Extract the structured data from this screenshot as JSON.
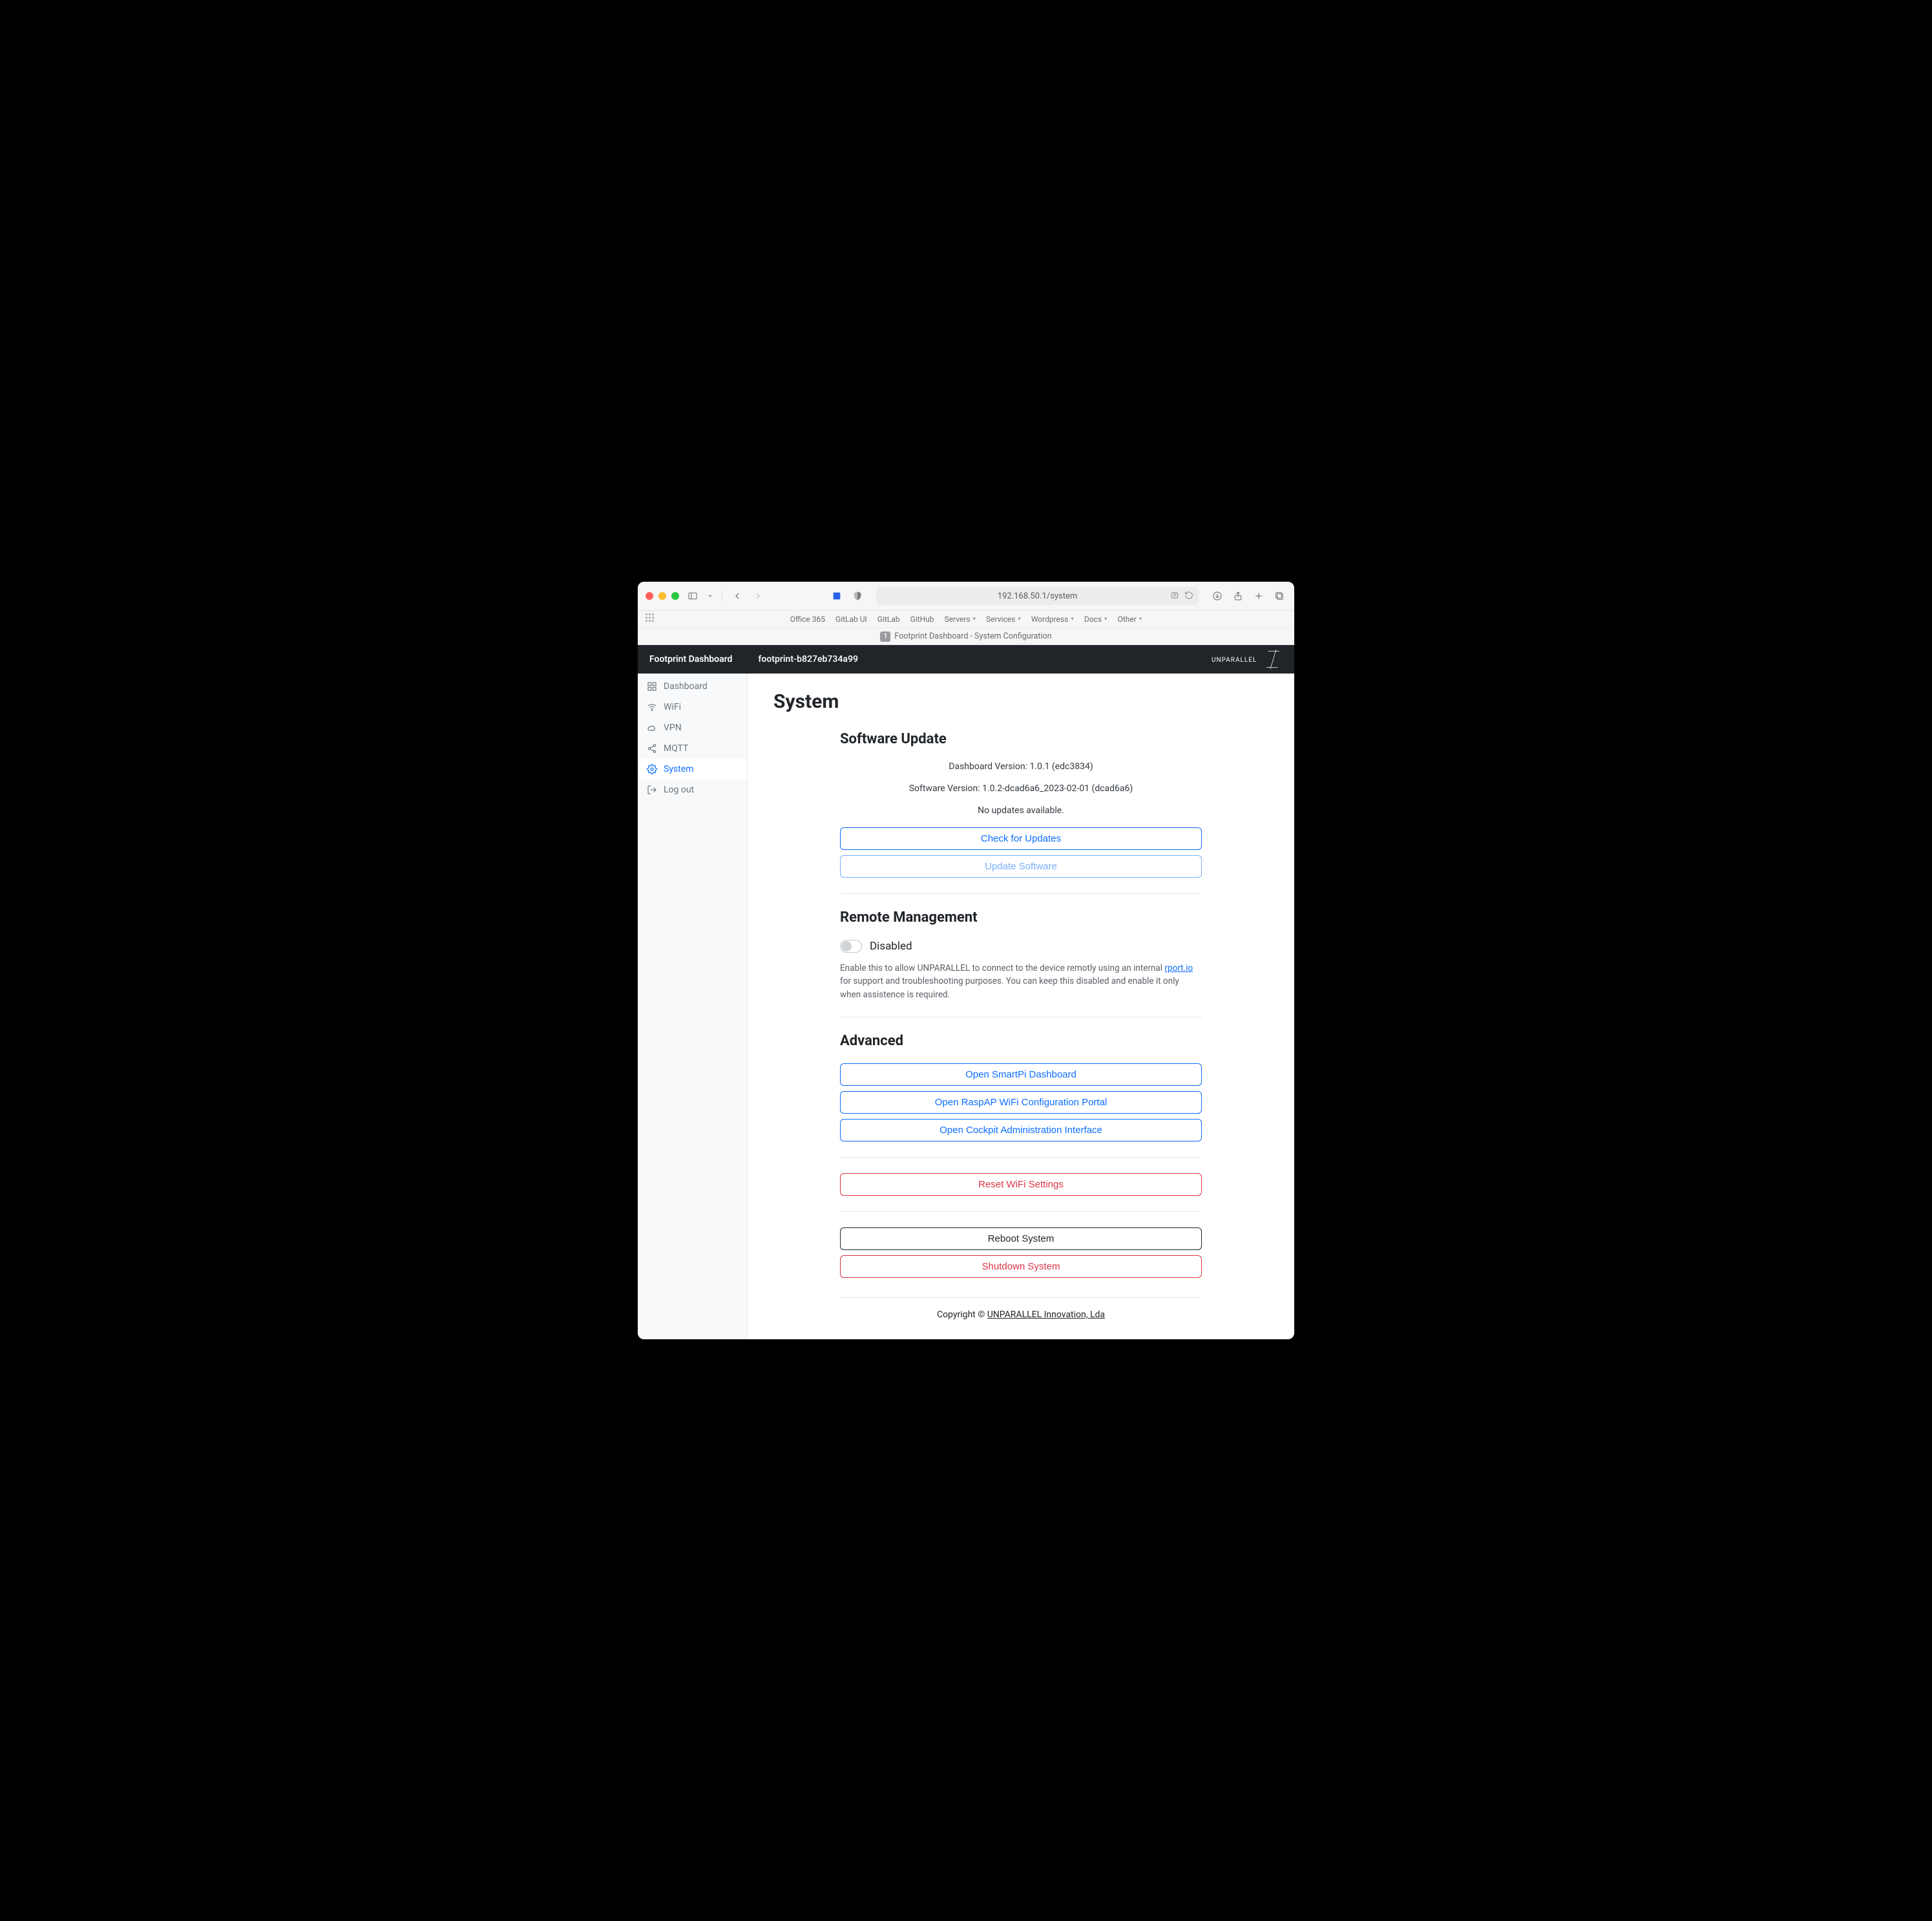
{
  "browser": {
    "url": "192.168.50.1/system",
    "favorites": [
      "Office 365",
      "GitLab UI",
      "GitLab",
      "GitHub",
      "Servers",
      "Services",
      "Wordpress",
      "Docs",
      "Other"
    ],
    "favorites_dropdown": {
      "Servers": true,
      "Services": true,
      "Wordpress": true,
      "Docs": true,
      "Other": true
    },
    "tab_title": "Footprint Dashboard - System Configuration"
  },
  "appbar": {
    "brand": "Footprint Dashboard",
    "host": "footprint-b827eb734a99",
    "logo_text": "UNPARALLEL"
  },
  "sidebar": {
    "items": [
      {
        "label": "Dashboard",
        "icon": "dashboard-icon",
        "active": false
      },
      {
        "label": "WiFi",
        "icon": "wifi-icon",
        "active": false
      },
      {
        "label": "VPN",
        "icon": "cloud-icon",
        "active": false
      },
      {
        "label": "MQTT",
        "icon": "share-icon",
        "active": false
      },
      {
        "label": "System",
        "icon": "gear-icon",
        "active": true
      },
      {
        "label": "Log out",
        "icon": "logout-icon",
        "active": false
      }
    ]
  },
  "page": {
    "title": "System",
    "software_update": {
      "heading": "Software Update",
      "dashboard_version_label": "Dashboard Version:",
      "dashboard_version": "1.0.1 (edc3834)",
      "software_version_label": "Software Version:",
      "software_version": "1.0.2-dcad6a6_2023-02-01 (dcad6a6)",
      "status": "No updates available.",
      "check_btn": "Check for Updates",
      "update_btn": "Update Software"
    },
    "remote": {
      "heading": "Remote Management",
      "state_label": "Disabled",
      "help_pre": "Enable this to allow UNPARALLEL to connect to the device remotly using an internal ",
      "help_link": "rport.io",
      "help_post": " for support and troubleshooting purposes. You can keep this disabled and enable it only when assistence is required."
    },
    "advanced": {
      "heading": "Advanced",
      "smartpi_btn": "Open SmartPi Dashboard",
      "raspap_btn": "Open RaspAP WiFi Configuration Portal",
      "cockpit_btn": "Open Cockpit Administration Interface",
      "resetwifi_btn": "Reset WiFi Settings",
      "reboot_btn": "Reboot System",
      "shutdown_btn": "Shutdown System"
    }
  },
  "footer": {
    "prefix": "Copyright © ",
    "company": "UNPARALLEL Innovation, Lda"
  }
}
